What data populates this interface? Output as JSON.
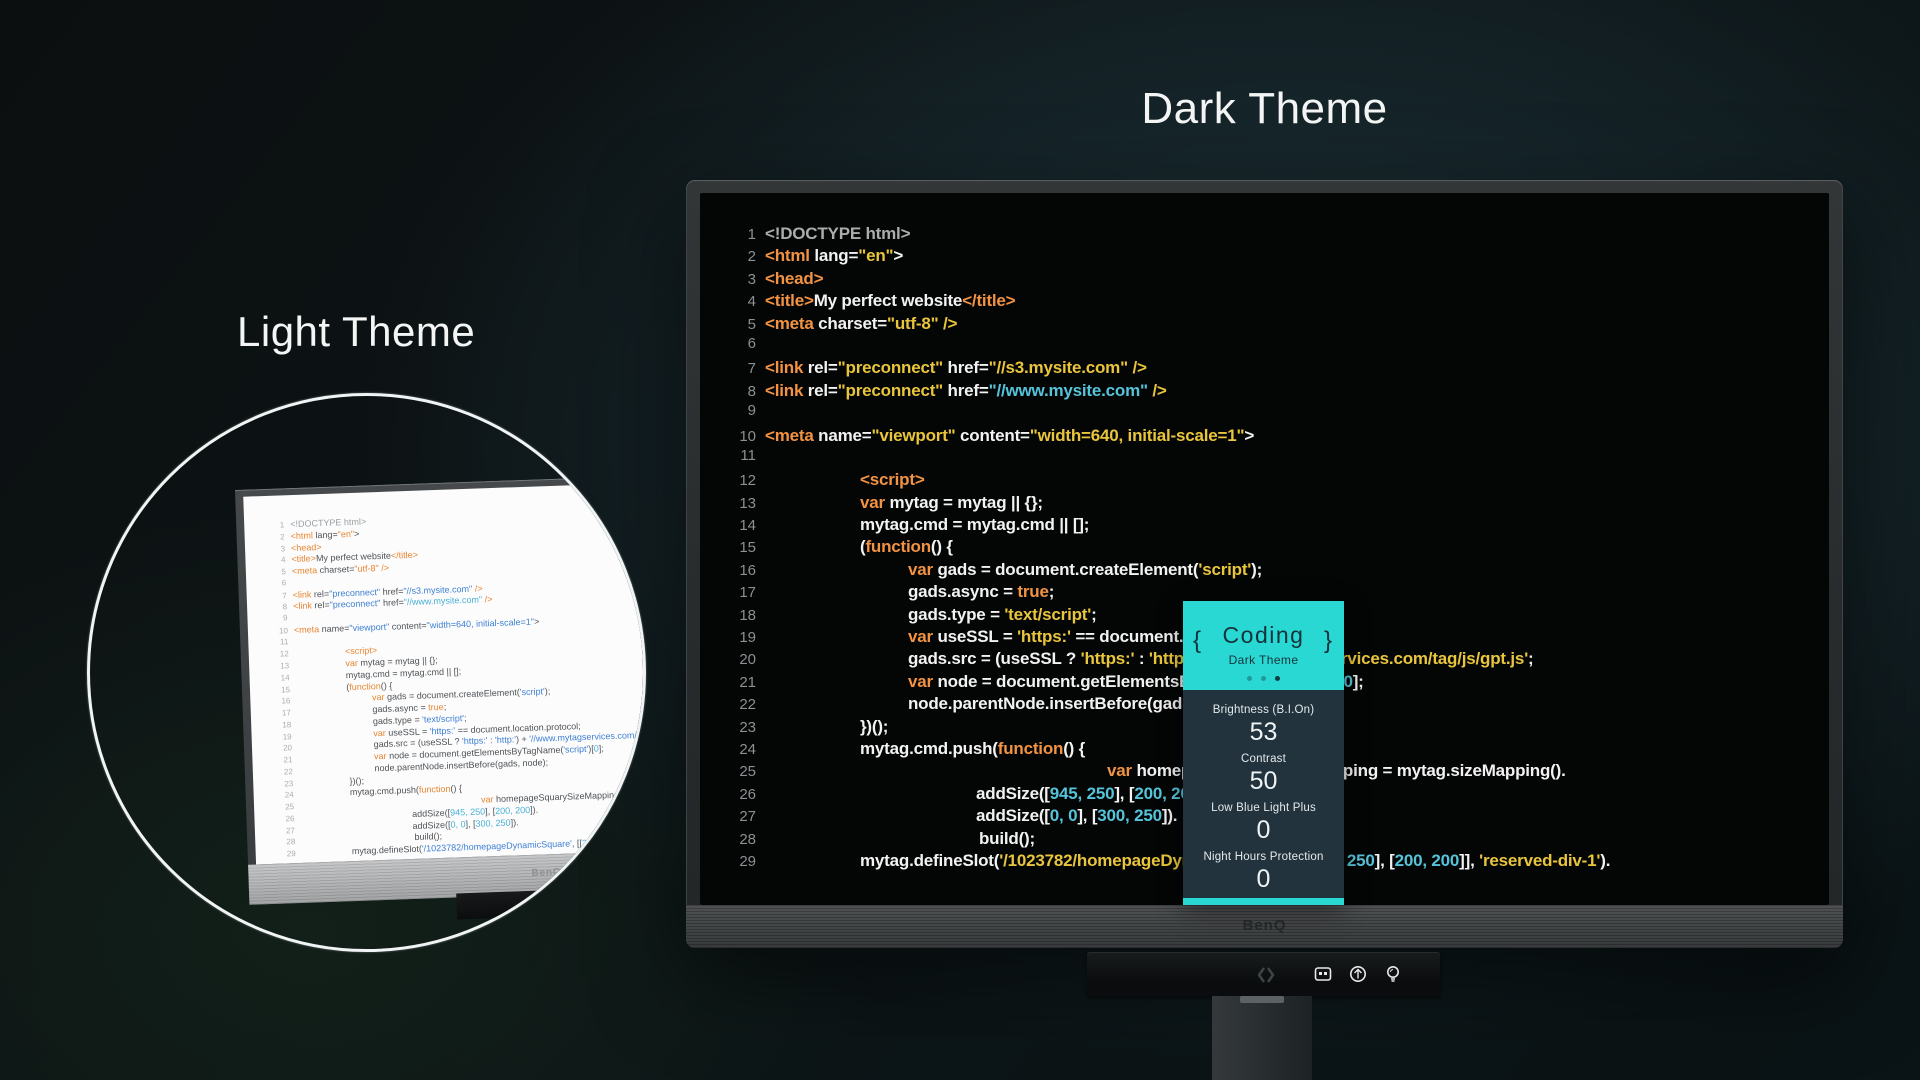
{
  "headings": {
    "dark": "Dark Theme",
    "light": "Light Theme"
  },
  "brand": {
    "name": "BenQ"
  },
  "osd": {
    "title": "Coding",
    "subtitle": "Dark Theme",
    "left_brace": "{",
    "right_brace": "}",
    "accent_color": "#29d8d2",
    "panel_color": "#22333e",
    "dots": {
      "count": 3,
      "active_index": 2
    },
    "settings": [
      {
        "label": "Brightness (B.I.On)",
        "value": "53"
      },
      {
        "label": "Contrast",
        "value": "50"
      },
      {
        "label": "Low Blue Light Plus",
        "value": "0"
      },
      {
        "label": "Night Hours Protection",
        "value": "0"
      }
    ]
  },
  "monitor_controls": {
    "icons": [
      "code-brackets-icon",
      "osd-controller-icon",
      "menu-joystick-icon",
      "lightbulb-icon"
    ],
    "faint_code_icon": "❮❯"
  },
  "code": {
    "token_classes": {
      "t": "tag-orange",
      "k": "keyword-orange",
      "s": "string",
      "s2": "string-alt",
      "c": "number-cyan",
      "w": "plain",
      "g": "comment-grey"
    },
    "colors_dark": {
      "tag": "#f29243",
      "string": "#e9c53d",
      "number": "#55c4da",
      "plain": "#f2f2f2",
      "grey": "#a9adae"
    },
    "colors_light": {
      "tag": "#e8852f",
      "string": "#3d7fd2",
      "number": "#47b0d6",
      "plain": "#4e5356",
      "grey": "#9aa0a2"
    },
    "lines": [
      {
        "n": 1,
        "i": 0,
        "t": [
          [
            "g",
            "<!DOCTYPE html>"
          ]
        ]
      },
      {
        "n": 2,
        "i": 0,
        "t": [
          [
            "t",
            "<html"
          ],
          [
            "w",
            " lang="
          ],
          [
            "s2",
            "\"en\""
          ],
          [
            "w",
            ">"
          ]
        ]
      },
      {
        "n": 3,
        "i": 0,
        "t": [
          [
            "t",
            "<head>"
          ]
        ]
      },
      {
        "n": 4,
        "i": 0,
        "t": [
          [
            "t",
            "<title>"
          ],
          [
            "w",
            "My perfect website"
          ],
          [
            "t",
            "</title>"
          ]
        ]
      },
      {
        "n": 5,
        "i": 0,
        "t": [
          [
            "t",
            "<meta"
          ],
          [
            "w",
            " charset="
          ],
          [
            "s2",
            "\"utf-8\""
          ],
          [
            "s2",
            " />"
          ]
        ]
      },
      {
        "n": 6,
        "i": 0,
        "t": []
      },
      {
        "n": 7,
        "i": 0,
        "t": [
          [
            "t",
            "<link"
          ],
          [
            "w",
            " rel="
          ],
          [
            "s",
            "\"preconnect\""
          ],
          [
            "w",
            " href="
          ],
          [
            "s",
            "\"//s3.mysite.com\""
          ],
          [
            "s2",
            " />"
          ]
        ]
      },
      {
        "n": 8,
        "i": 0,
        "t": [
          [
            "t",
            "<link"
          ],
          [
            "w",
            " rel="
          ],
          [
            "s",
            "\"preconnect\""
          ],
          [
            "w",
            " href="
          ],
          [
            "c",
            "\"//www.mysite.com\""
          ],
          [
            "s2",
            " />"
          ]
        ]
      },
      {
        "n": 9,
        "i": 0,
        "t": []
      },
      {
        "n": 10,
        "i": 0,
        "t": [
          [
            "t",
            "<meta"
          ],
          [
            "w",
            " name="
          ],
          [
            "s",
            "\"viewport\""
          ],
          [
            "w",
            " content="
          ],
          [
            "s",
            "\"width=640, initial-scale=1\""
          ],
          [
            "w",
            ">"
          ]
        ]
      },
      {
        "n": 11,
        "i": 0,
        "t": []
      },
      {
        "n": 12,
        "i": 95,
        "t": [
          [
            "t",
            "<script>"
          ]
        ]
      },
      {
        "n": 13,
        "i": 95,
        "t": [
          [
            "k",
            "var"
          ],
          [
            "w",
            " mytag = mytag || {};"
          ]
        ]
      },
      {
        "n": 14,
        "i": 95,
        "t": [
          [
            "w",
            "mytag.cmd = mytag.cmd || [];"
          ]
        ]
      },
      {
        "n": 15,
        "i": 95,
        "t": [
          [
            "w",
            "("
          ],
          [
            "k",
            "function"
          ],
          [
            "w",
            "() {"
          ]
        ]
      },
      {
        "n": 16,
        "i": 143,
        "t": [
          [
            "k",
            "var"
          ],
          [
            "w",
            " gads = document.createElement("
          ],
          [
            "s",
            "'script'"
          ],
          [
            "w",
            ");"
          ]
        ]
      },
      {
        "n": 17,
        "i": 143,
        "t": [
          [
            "w",
            "gads.async = "
          ],
          [
            "k",
            "true"
          ],
          [
            "w",
            ";"
          ]
        ]
      },
      {
        "n": 18,
        "i": 143,
        "t": [
          [
            "w",
            "gads.type = "
          ],
          [
            "s",
            "'text/script'"
          ],
          [
            "w",
            ";"
          ]
        ]
      },
      {
        "n": 19,
        "i": 143,
        "t": [
          [
            "k",
            "var"
          ],
          [
            "w",
            " useSSL = "
          ],
          [
            "s",
            "'https:'"
          ],
          [
            "w",
            " == document.location.protocol;"
          ]
        ]
      },
      {
        "n": 20,
        "i": 143,
        "t": [
          [
            "w",
            "gads.src = (useSSL ? "
          ],
          [
            "s",
            "'https:'"
          ],
          [
            "w",
            " : "
          ],
          [
            "s",
            "'http:'"
          ],
          [
            "w",
            ") + "
          ],
          [
            "s",
            "'//www.mytagservices.com/tag/js/gpt.js'"
          ],
          [
            "w",
            ";"
          ]
        ]
      },
      {
        "n": 21,
        "i": 143,
        "t": [
          [
            "k",
            "var"
          ],
          [
            "w",
            " node = document.getElementsByTagName("
          ],
          [
            "s",
            "'script'"
          ],
          [
            "w",
            ")["
          ],
          [
            "c",
            "0"
          ],
          [
            "w",
            "];"
          ]
        ]
      },
      {
        "n": 22,
        "i": 143,
        "t": [
          [
            "w",
            "node.parentNode.insertBefore(gads, node);"
          ]
        ]
      },
      {
        "n": 23,
        "i": 95,
        "t": [
          [
            "w",
            "})();"
          ]
        ]
      },
      {
        "n": 24,
        "i": 95,
        "t": [
          [
            "w",
            "mytag.cmd.push("
          ],
          [
            "k",
            "function"
          ],
          [
            "w",
            "() {"
          ]
        ]
      },
      {
        "n": 25,
        "i": 342,
        "t": [
          [
            "k",
            "var"
          ],
          [
            "w",
            " homepageSquarySizeMapping = mytag.sizeMapping()."
          ]
        ]
      },
      {
        "n": 26,
        "i": 211,
        "t": [
          [
            "w",
            "addSize(["
          ],
          [
            "c",
            "945, 250"
          ],
          [
            "w",
            "], ["
          ],
          [
            "c",
            "200, 200"
          ],
          [
            "w",
            "])."
          ]
        ]
      },
      {
        "n": 27,
        "i": 211,
        "t": [
          [
            "w",
            "addSize(["
          ],
          [
            "c",
            "0, 0"
          ],
          [
            "w",
            "], ["
          ],
          [
            "c",
            "300, 250"
          ],
          [
            "w",
            "])."
          ]
        ]
      },
      {
        "n": 28,
        "i": 214,
        "t": [
          [
            "w",
            "build();"
          ]
        ]
      },
      {
        "n": 29,
        "i": 95,
        "t": [
          [
            "w",
            "mytag.defineSlot("
          ],
          [
            "s",
            "'/1023782/homepageDynamicSquare'"
          ],
          [
            "w",
            ", [["
          ],
          [
            "c",
            "300, 250"
          ],
          [
            "w",
            "], ["
          ],
          [
            "c",
            "200, 200"
          ],
          [
            "w",
            "]], "
          ],
          [
            "s",
            "'reserved-div-1'"
          ],
          [
            "w",
            ")."
          ]
        ]
      }
    ]
  }
}
